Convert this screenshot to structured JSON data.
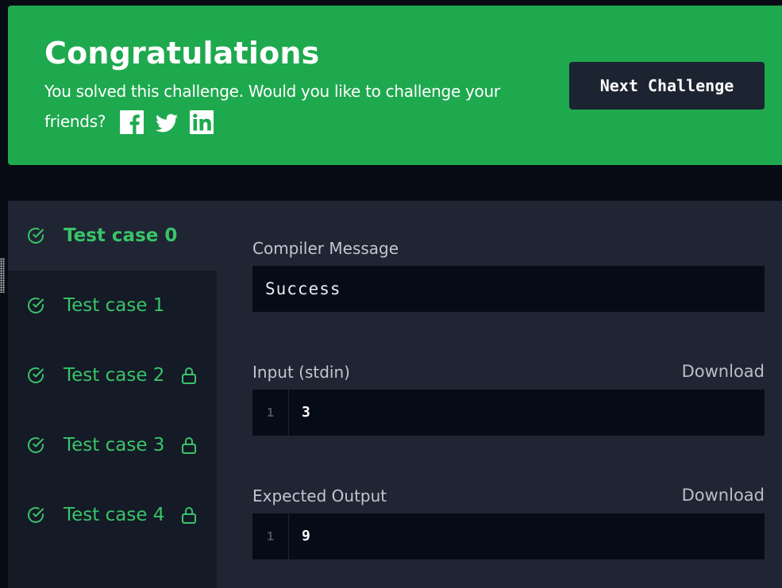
{
  "banner": {
    "title": "Congratulations",
    "message": "You solved this challenge. Would you like to challenge your friends?",
    "social": [
      "facebook-icon",
      "twitter-icon",
      "linkedin-icon"
    ],
    "next_button_label": "Next Challenge",
    "bg_color": "#1ea94e"
  },
  "test_cases": [
    {
      "label": "Test case 0",
      "passed": true,
      "locked": false,
      "active": true
    },
    {
      "label": "Test case 1",
      "passed": true,
      "locked": false,
      "active": false
    },
    {
      "label": "Test case 2",
      "passed": true,
      "locked": true,
      "active": false
    },
    {
      "label": "Test case 3",
      "passed": true,
      "locked": true,
      "active": false
    },
    {
      "label": "Test case 4",
      "passed": true,
      "locked": true,
      "active": false
    }
  ],
  "compiler": {
    "label": "Compiler Message",
    "value": "Success"
  },
  "input": {
    "label": "Input (stdin)",
    "download_label": "Download",
    "line_number": "1",
    "value": "3"
  },
  "expected_output": {
    "label": "Expected Output",
    "download_label": "Download",
    "line_number": "1",
    "value": "9"
  },
  "colors": {
    "accent_green": "#39c46a",
    "panel_bg": "#1f2532",
    "sidebar_bg": "#141a26",
    "code_bg": "#060b18"
  }
}
